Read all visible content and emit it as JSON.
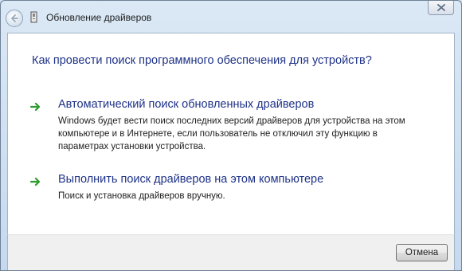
{
  "window": {
    "title": "Обновление драйверов"
  },
  "content": {
    "question": "Как провести поиск программного обеспечения для устройств?",
    "options": [
      {
        "title": "Автоматический поиск обновленных драйверов",
        "description": "Windows будет вести поиск последних версий драйверов для устройства на этом компьютере и в Интернете, если пользователь не отключил эту функцию в параметрах установки устройства."
      },
      {
        "title": "Выполнить поиск драйверов на этом компьютере",
        "description": "Поиск и установка драйверов вручную."
      }
    ]
  },
  "footer": {
    "cancel_label": "Отмена"
  },
  "icons": {
    "back": "back-arrow-icon",
    "app": "device-driver-icon",
    "close": "close-icon",
    "option_arrow": "green-arrow-icon"
  },
  "colors": {
    "link_blue": "#1e3287",
    "arrow_green": "#2f9b2f"
  }
}
